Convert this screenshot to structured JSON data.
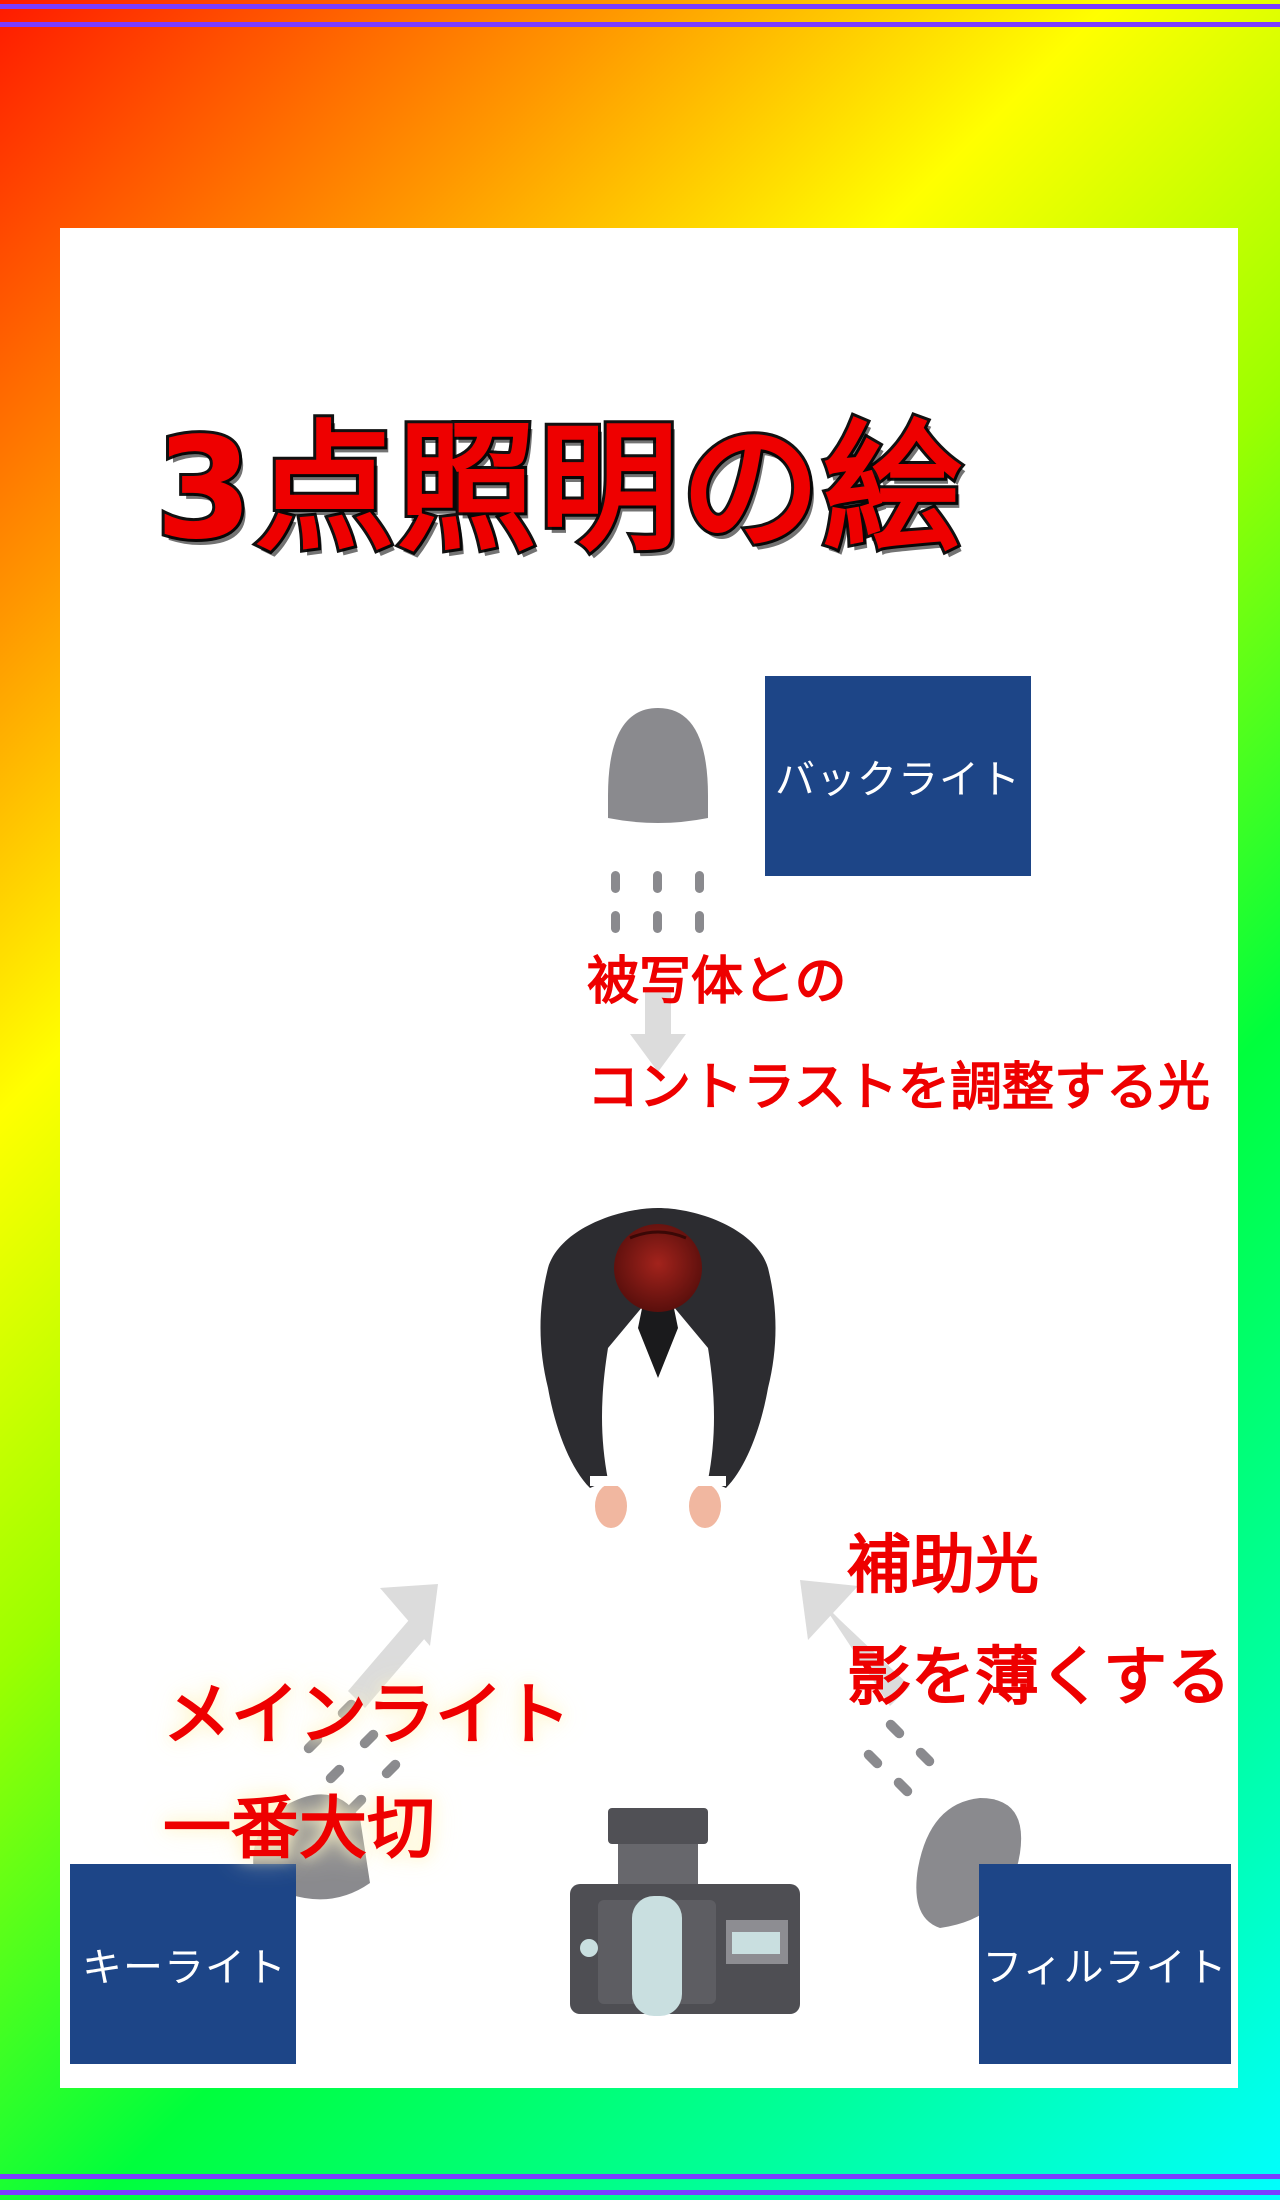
{
  "title": "3点照明の絵",
  "labels": {
    "back_light": "バックライト",
    "key_light": "キーライト",
    "fill_light": "フィルライト"
  },
  "annotations": {
    "back_line1": "被写体との",
    "back_line2": "コントラストを調整する光",
    "fill_line1": "補助光",
    "fill_line2": "影を薄くする",
    "key_line1": "メインライト",
    "key_line2": "一番大切"
  },
  "colors": {
    "title": "#ee0000",
    "label_bg": "#1d4587",
    "annotation": "#ee0000",
    "light_icon": "#8a8a8e",
    "arrow": "#dcdcdc"
  },
  "icons": [
    "spotlight-icon",
    "person-icon",
    "camera-icon",
    "arrow-icon"
  ]
}
